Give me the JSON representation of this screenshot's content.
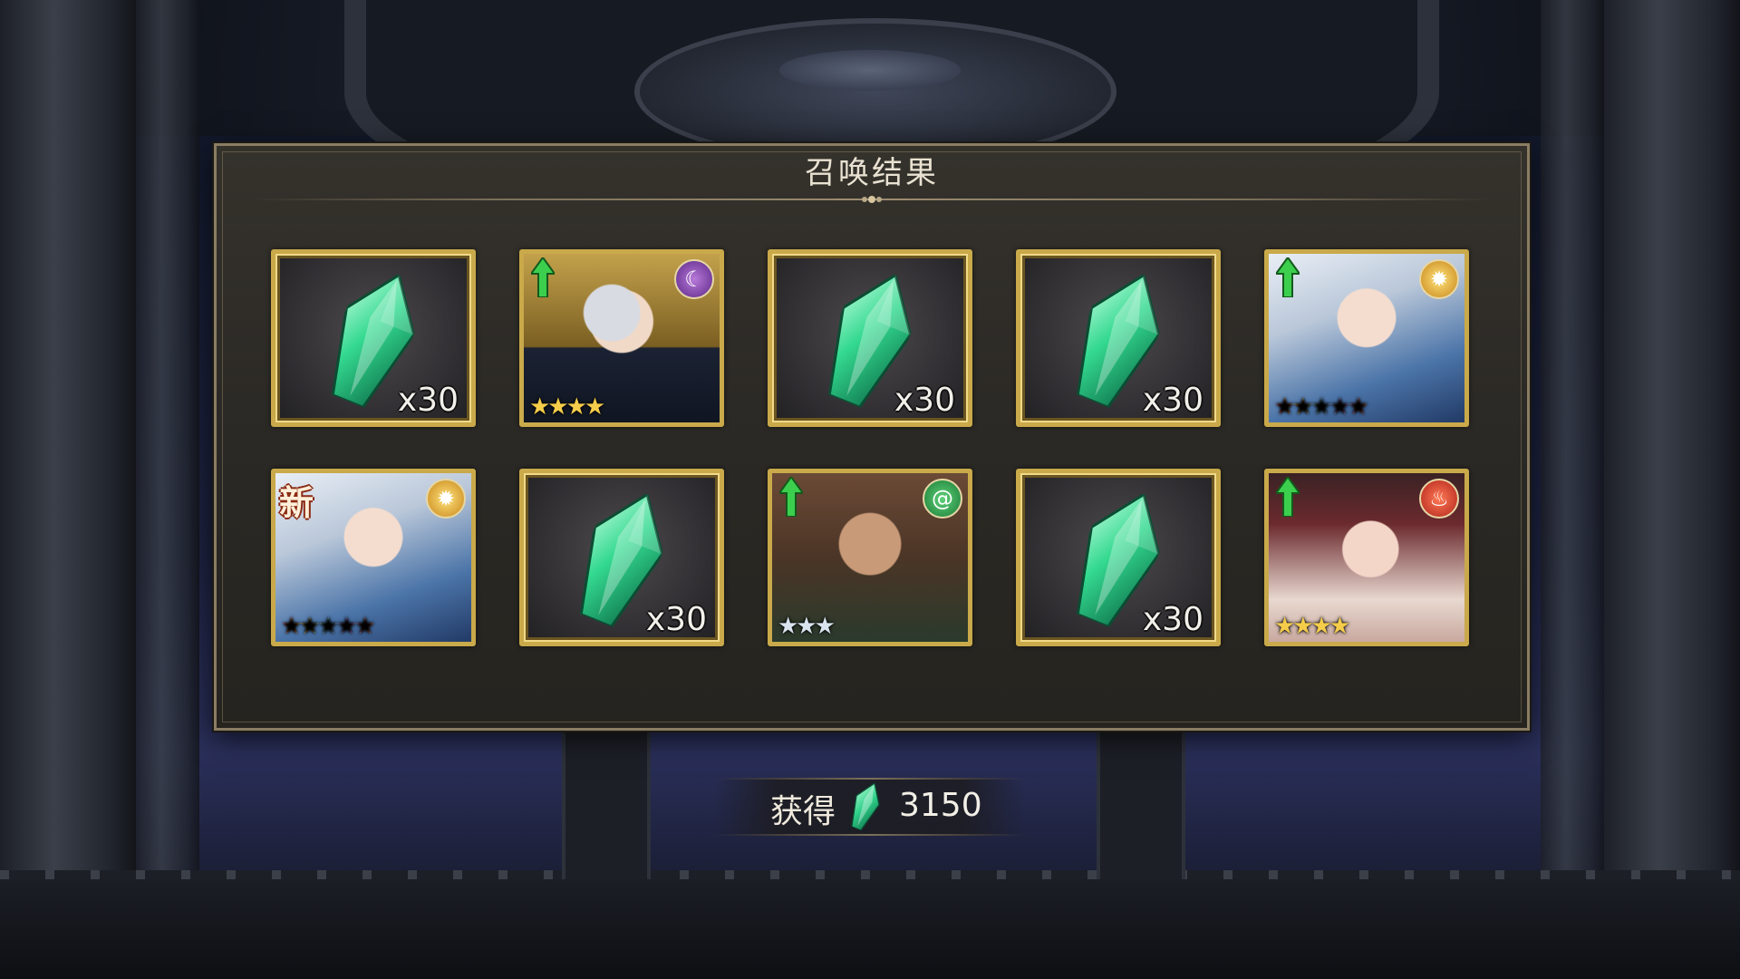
{
  "dialog": {
    "title": "召唤结果"
  },
  "results": [
    {
      "type": "crystal",
      "quantity": "x30"
    },
    {
      "type": "character",
      "stars": "★★★★",
      "star_style": "gold",
      "element": "dark",
      "element_icon": "moon-icon",
      "upgrade": true,
      "is_new": false
    },
    {
      "type": "crystal",
      "quantity": "x30"
    },
    {
      "type": "crystal",
      "quantity": "x30"
    },
    {
      "type": "character",
      "stars": "★★★★★",
      "star_style": "rainbow",
      "element": "light",
      "element_icon": "sun-icon",
      "upgrade": true,
      "is_new": false
    },
    {
      "type": "character",
      "stars": "★★★★★",
      "star_style": "rainbow",
      "element": "light",
      "element_icon": "sun-icon",
      "upgrade": false,
      "is_new": true,
      "new_label": "新"
    },
    {
      "type": "crystal",
      "quantity": "x30"
    },
    {
      "type": "character",
      "stars": "★★★",
      "star_style": "silver",
      "element": "wind",
      "element_icon": "swirl-icon",
      "upgrade": true,
      "is_new": false
    },
    {
      "type": "crystal",
      "quantity": "x30"
    },
    {
      "type": "character",
      "stars": "★★★★",
      "star_style": "gold",
      "element": "fire",
      "element_icon": "flame-icon",
      "upgrade": true,
      "is_new": false
    }
  ],
  "obtained": {
    "label": "获得",
    "icon": "crystal-icon",
    "amount": "3150"
  },
  "colors": {
    "frame_gold": "#c9a94a",
    "crystal_green": "#2fd08a",
    "upgrade_green": "#3ccf4e",
    "dialog_bg": "#2b2925"
  }
}
